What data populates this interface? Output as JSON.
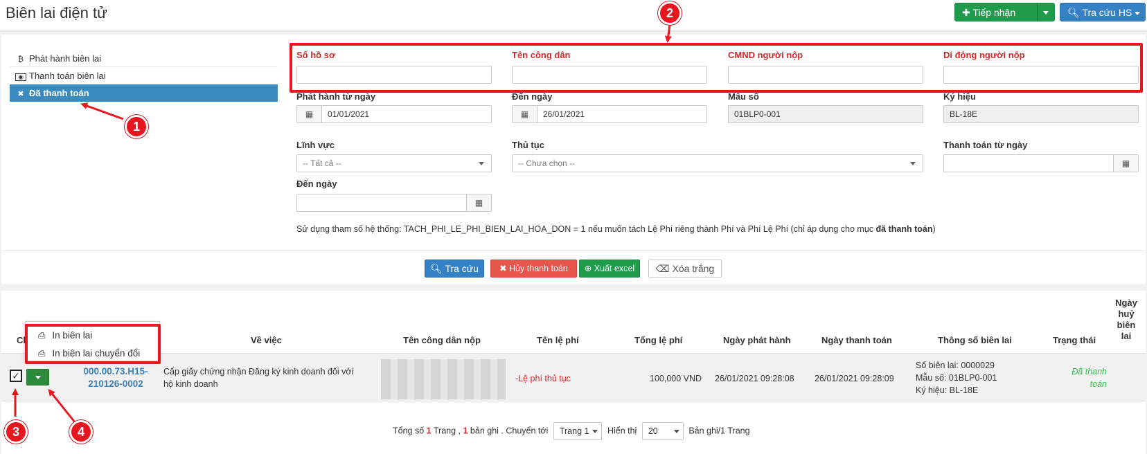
{
  "header": {
    "title": "Biên lai điện tử",
    "receive_label": "Tiếp nhận",
    "lookup_hs_label": "Tra cứu HS"
  },
  "sidebar": {
    "items": [
      {
        "icon": "bitcoin-icon",
        "label": "Phát hành biên lai"
      },
      {
        "icon": "money-icon",
        "label": "Thanh toán biên lai"
      },
      {
        "icon": "x-icon",
        "label": "Đã thanh toán"
      }
    ]
  },
  "filters": {
    "so_ho_so": {
      "label": "Số hồ sơ",
      "value": ""
    },
    "ten_cong_dan": {
      "label": "Tên công dân",
      "value": ""
    },
    "cmnd": {
      "label": "CMND người nộp",
      "value": ""
    },
    "di_dong": {
      "label": "Di động người nộp",
      "value": ""
    },
    "phat_hanh_tu": {
      "label": "Phát hành từ ngày",
      "value": "01/01/2021"
    },
    "den_ngay": {
      "label": "Đến ngày",
      "value": "26/01/2021"
    },
    "mau_so": {
      "label": "Mẫu số",
      "value": "01BLP0-001"
    },
    "ky_hieu": {
      "label": "Ký hiệu",
      "value": "BL-18E"
    },
    "linh_vuc": {
      "label": "Lĩnh vực",
      "value": "-- Tất cả --"
    },
    "thu_tuc": {
      "label": "Thủ tục",
      "value": "-- Chưa chọn --"
    },
    "thanh_toan_tu": {
      "label": "Thanh toán từ ngày",
      "value": ""
    },
    "den_ngay_2": {
      "label": "Đến ngày",
      "value": ""
    }
  },
  "note": {
    "text": "Sử dụng tham số hệ thống: TACH_PHI_LE_PHI_BIEN_LAI_HOA_DON = 1 nếu muốn tách Lệ Phí riêng thành Phí và Phí Lệ Phí (chỉ áp dụng cho mục ",
    "bold": "đã thanh toán",
    "end": ")"
  },
  "actions": {
    "search": "Tra cứu",
    "cancel_payment": "Hủy thanh toán",
    "export_excel": "Xuất excel",
    "clear": "Xóa trắng"
  },
  "table": {
    "headers": {
      "chon": "Ch",
      "ve_viec": "Về việc",
      "ten_cong_dan_nop": "Tên công dân nộp",
      "ten_le_phi": "Tên lệ phí",
      "tong_le_phi": "Tổng lệ phí",
      "ngay_phat_hanh": "Ngày phát hành",
      "ngay_thanh_toan": "Ngày thanh toán",
      "thong_so": "Thông số biên lai",
      "trang_thai": "Trạng thái",
      "ngay_huy": [
        "Ngày",
        "huỷ",
        "biên",
        "lai"
      ]
    },
    "rows": [
      {
        "ma_hs": [
          "000.00.73.H15-",
          "210126-0002"
        ],
        "ve_viec": [
          "Cấp giấy chứng nhận Đăng ký kinh doanh đối với",
          "hộ kinh doanh"
        ],
        "ten_le_phi": "-Lệ phí thủ tục",
        "tong_le_phi": "100,000 VND",
        "ngay_phat_hanh": "26/01/2021 09:28:08",
        "ngay_thanh_toan": "26/01/2021 09:28:09",
        "thong_so": [
          "Số biên lai: 0000029",
          "Mẫu số: 01BLP0-001",
          "Ký hiệu: BL-18E"
        ],
        "trang_thai": [
          "Đã thanh",
          "toán"
        ]
      }
    ]
  },
  "row_menu": {
    "items": [
      "In biên lai",
      "In biên lai chuyển đổi"
    ]
  },
  "pager": {
    "prefix": "Tổng số",
    "pages": "1",
    "pages_label": "Trang ,",
    "records": "1",
    "records_label": "bản ghi . Chuyển tới",
    "page_select": "Trang 1",
    "show_label": "Hiển thị",
    "per_page": "20",
    "suffix": "Bản ghi/1 Trang"
  },
  "annotations": [
    "1",
    "2",
    "3",
    "4"
  ],
  "colors": {
    "accent_red": "#e8161e",
    "sidebar_active": "#3a8cc0",
    "link": "#3a7eb8"
  }
}
